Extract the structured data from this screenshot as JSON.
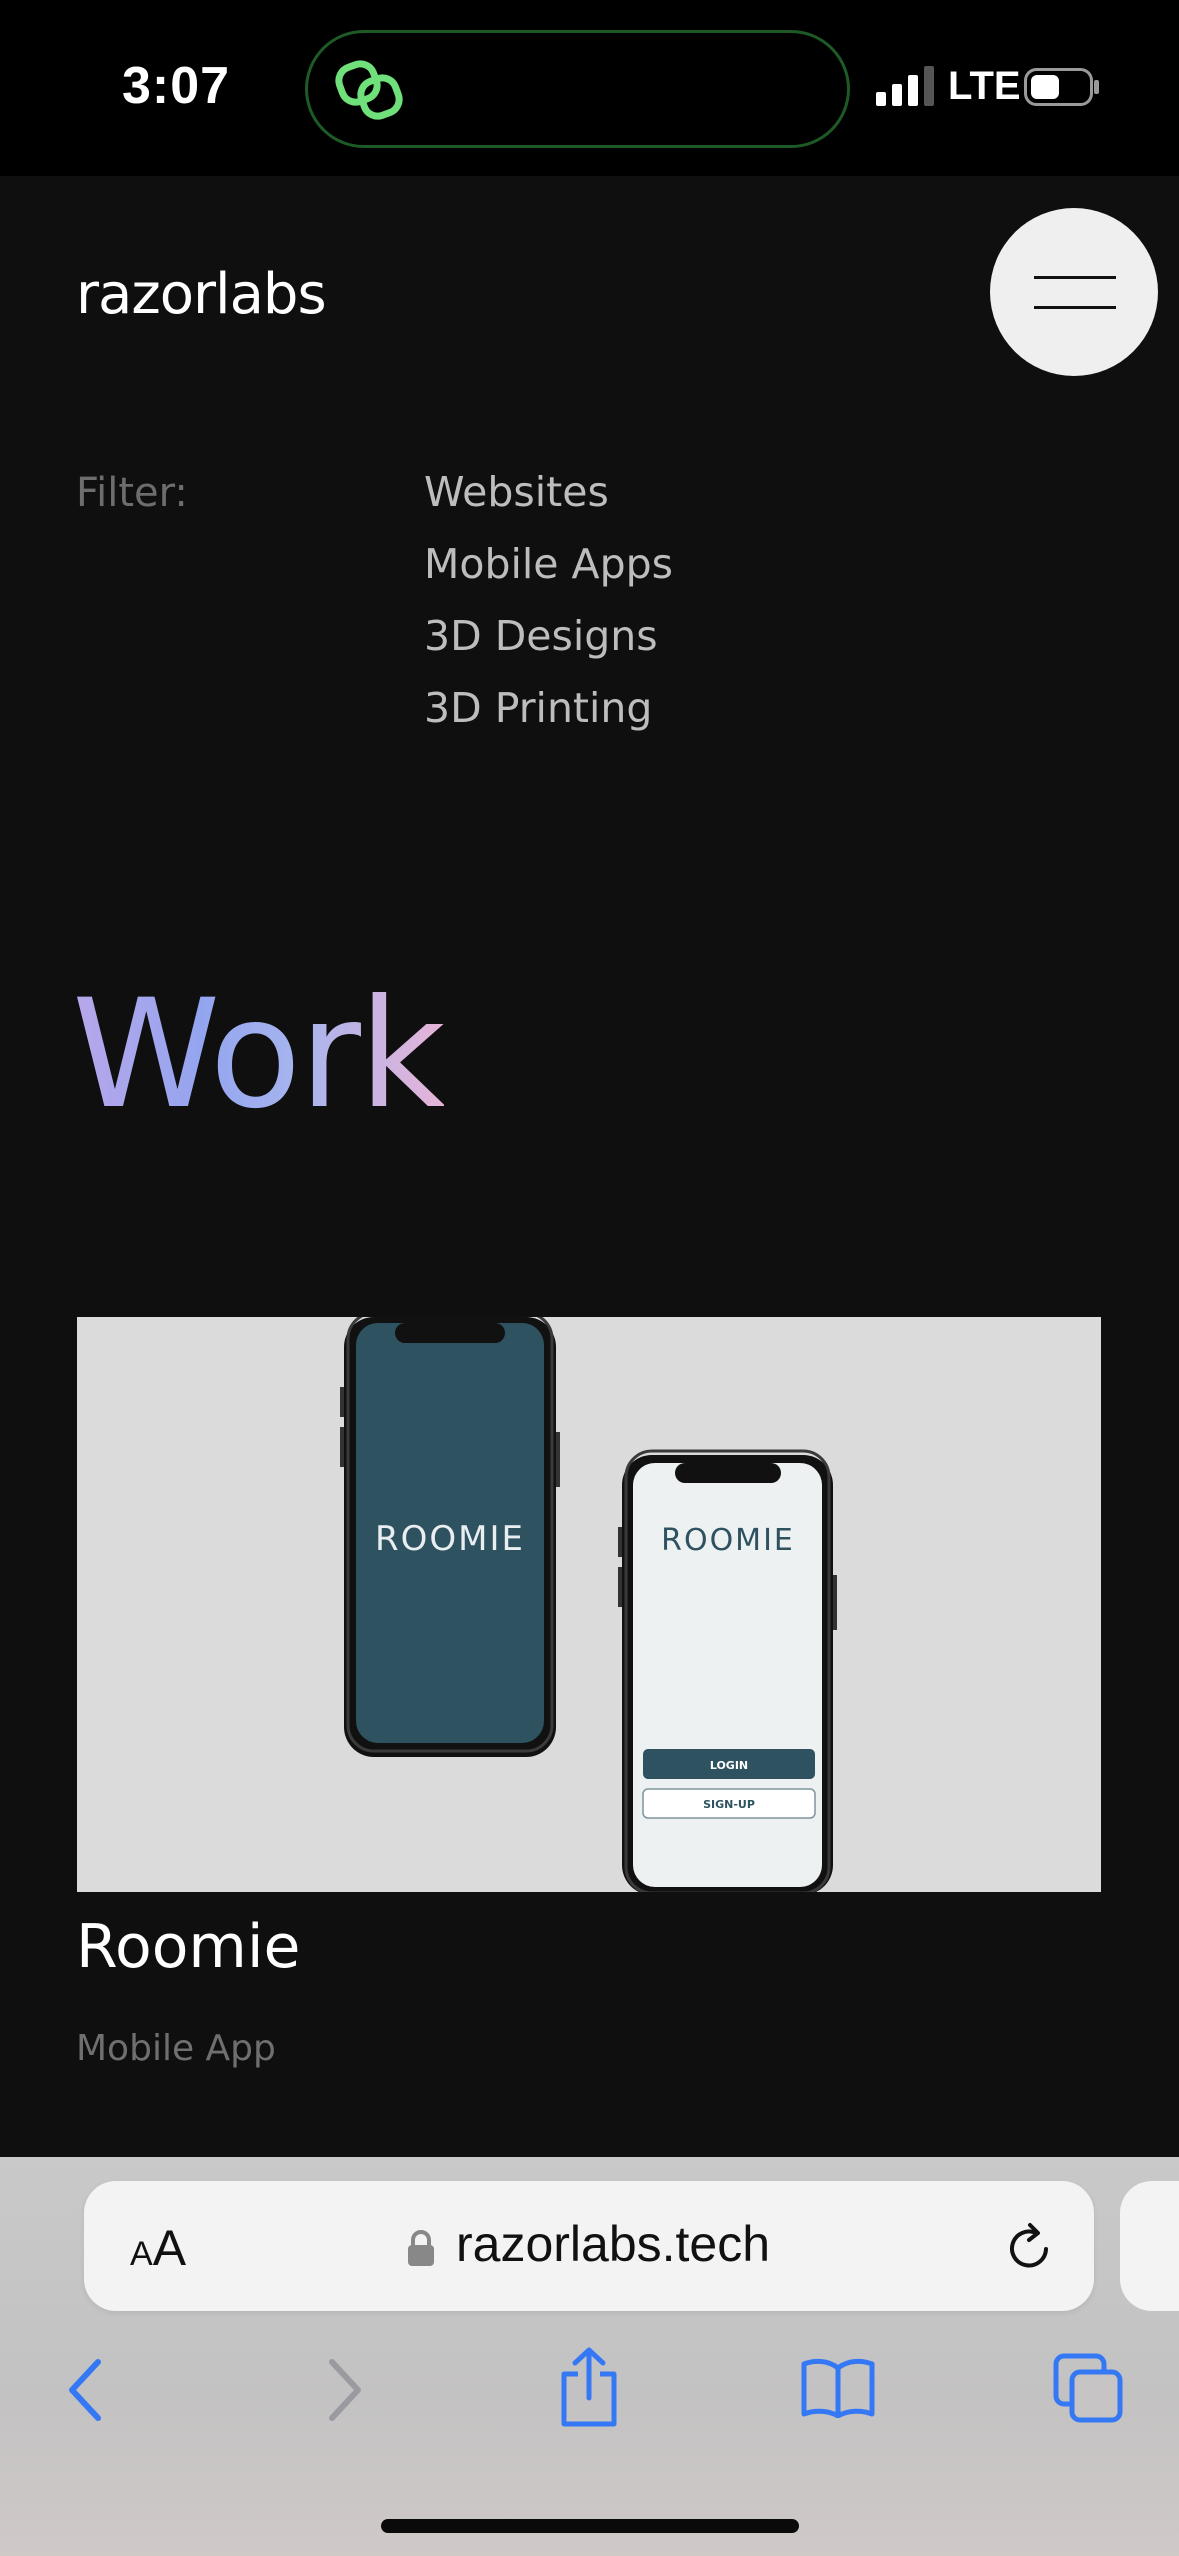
{
  "status_bar": {
    "time": "3:07",
    "network": "LTE",
    "island_icon": "link-rings-icon",
    "island_accent": "#6fe07a"
  },
  "header": {
    "logo": "razorlabs",
    "menu_icon": "hamburger-icon"
  },
  "filter": {
    "label": "Filter:",
    "options": [
      "Websites",
      "Mobile Apps",
      "3D Designs",
      "3D Printing"
    ]
  },
  "main": {
    "title": "Work",
    "title_gradient": [
      "#b9a7ea",
      "#93a5ef",
      "#e7b4d8"
    ]
  },
  "project": {
    "title": "Roomie",
    "category": "Mobile App",
    "image": {
      "brand": "ROOMIE",
      "login_label": "LOGIN",
      "signup_label": "SIGN-UP",
      "screen_dark": "#2e5260"
    }
  },
  "browser": {
    "text_size_label_small": "A",
    "text_size_label_large": "A",
    "url": "razorlabs.tech",
    "accent": "#3478f6"
  }
}
